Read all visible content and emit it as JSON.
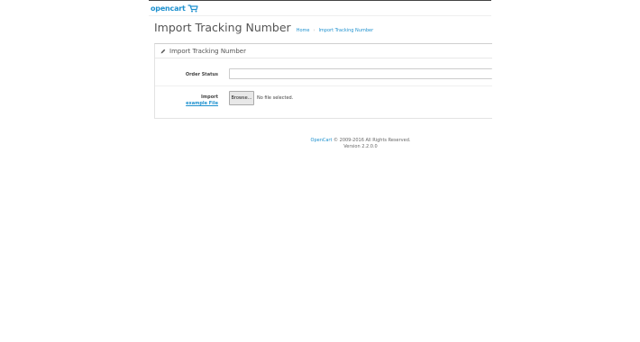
{
  "header": {
    "logo_text": "opencart"
  },
  "page": {
    "title": "Import Tracking Number",
    "breadcrumb": [
      {
        "label": "Home"
      },
      {
        "label": "Import Tracking Number"
      }
    ]
  },
  "panel": {
    "title": "Import Tracking Number",
    "order_status_label": "Order Status",
    "order_status_value": "",
    "import_label": "Import",
    "example_file_label": "example File",
    "browse_label": "Browse...",
    "file_status": "No file selected."
  },
  "footer": {
    "brand_link": "OpenCart",
    "copyright": " © 2009-2016 All Rights Reserved.",
    "version": "Version 2.2.0.0"
  },
  "colors": {
    "accent": "#1e91cf",
    "text": "#555555",
    "border": "#e3e3e3"
  },
  "icons": {
    "panel_icon": "pencil-icon",
    "logo_icon": "cart-icon"
  }
}
